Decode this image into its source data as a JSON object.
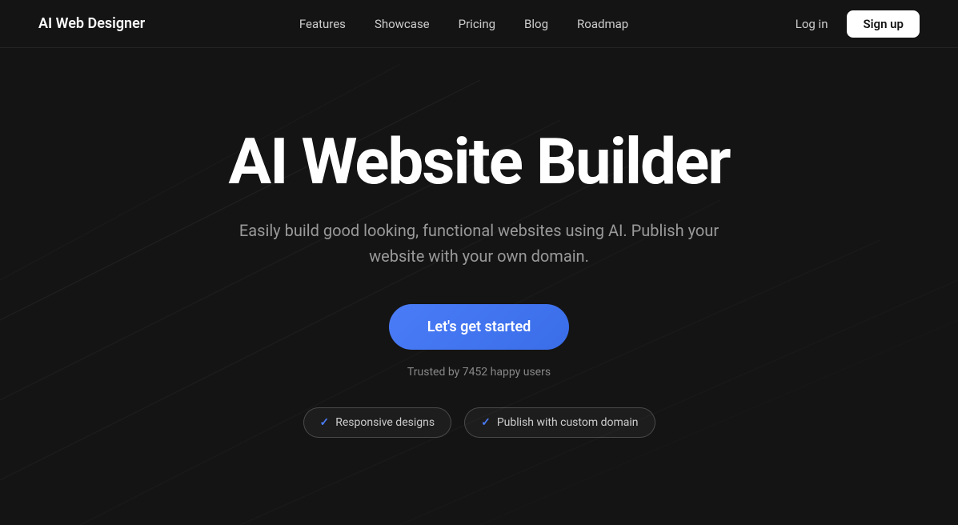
{
  "brand": {
    "name": "AI Web Designer"
  },
  "nav": {
    "links": [
      {
        "label": "Features",
        "id": "features"
      },
      {
        "label": "Showcase",
        "id": "showcase"
      },
      {
        "label": "Pricing",
        "id": "pricing"
      },
      {
        "label": "Blog",
        "id": "blog"
      },
      {
        "label": "Roadmap",
        "id": "roadmap"
      }
    ],
    "login_label": "Log in",
    "signup_label": "Sign up"
  },
  "hero": {
    "title": "AI Website Builder",
    "subtitle": "Easily build good looking, functional websites using AI. Publish your website with your own domain.",
    "cta_label": "Let's get started",
    "trust_text": "Trusted by 7452 happy users"
  },
  "badges": [
    {
      "label": "Responsive designs",
      "id": "responsive"
    },
    {
      "label": "Publish with custom domain",
      "id": "custom-domain"
    }
  ]
}
